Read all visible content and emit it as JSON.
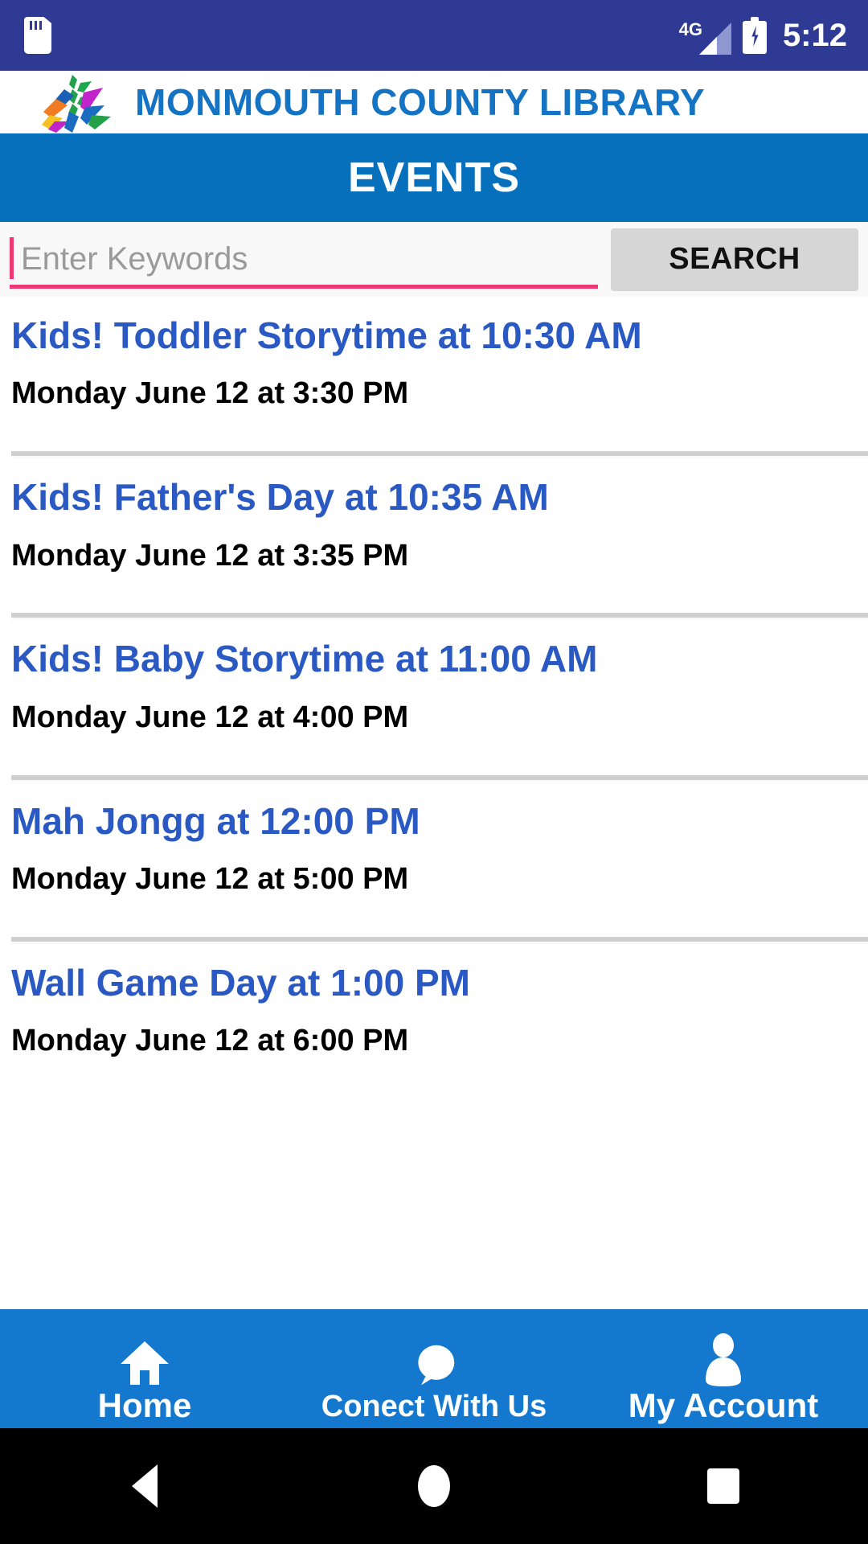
{
  "status_bar": {
    "sd_icon": "sd-card-icon",
    "network_label": "4G",
    "signal_icon": "signal-bars-icon",
    "battery_icon": "battery-charging-icon",
    "time": "5:12",
    "background_color": "#2E3A94"
  },
  "brand": {
    "logo_icon": "monmouth-library-leaf-logo",
    "name": "MONMOUTH COUNTY LIBRARY",
    "text_color": "#1573C4"
  },
  "page_header": {
    "title": "EVENTS",
    "background_color": "#0670BD"
  },
  "search": {
    "placeholder": "Enter Keywords",
    "value": "",
    "button_label": "SEARCH",
    "accent_color": "#ED3A72",
    "button_color": "#d6d6d6"
  },
  "events": [
    {
      "title": "Kids! Toddler Storytime  at 10:30 AM",
      "subtitle": "Monday June 12 at 3:30 PM"
    },
    {
      "title": "Kids! Father's Day  at 10:35 AM",
      "subtitle": "Monday June 12 at 3:35 PM"
    },
    {
      "title": "Kids! Baby Storytime  at 11:00 AM",
      "subtitle": "Monday June 12 at 4:00 PM"
    },
    {
      "title": "Mah Jongg  at 12:00 PM",
      "subtitle": "Monday June 12 at 5:00 PM"
    },
    {
      "title": "Wall Game Day  at 1:00 PM",
      "subtitle": "Monday June 12 at 6:00 PM"
    }
  ],
  "event_title_color": "#2B59C3",
  "bottom_nav": {
    "background_color": "#1479CE",
    "items": [
      {
        "label": "Home",
        "icon": "home-icon"
      },
      {
        "label": "Conect With Us",
        "icon": "speech-bubble-icon"
      },
      {
        "label": "My Account",
        "icon": "person-icon"
      }
    ]
  },
  "android_nav": {
    "back": "back-triangle-icon",
    "home": "home-circle-icon",
    "recents": "recents-square-icon"
  }
}
